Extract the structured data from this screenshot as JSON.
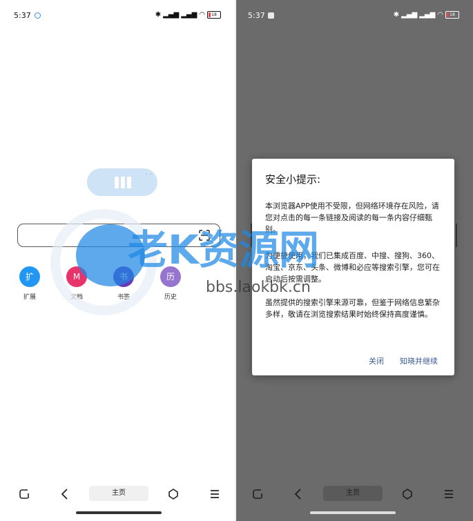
{
  "left_screen": {
    "status_bar": {
      "time": "5:37",
      "battery": "18",
      "signal_icons": [
        "bluetooth-icon",
        "signal-icon",
        "signal-icon",
        "wifi-icon",
        "battery-icon"
      ]
    },
    "search": {
      "value": "",
      "placeholder": "",
      "icon": "scan-icon"
    },
    "shortcuts": [
      {
        "glyph": "扩",
        "label": "扩展",
        "color": "#2196f3"
      },
      {
        "glyph": "M",
        "label": "文档",
        "color": "#e8336b"
      },
      {
        "glyph": "书",
        "label": "书签",
        "color": "#673ab7"
      },
      {
        "glyph": "历",
        "label": "历史",
        "color": "#9575cd"
      }
    ],
    "navbar": {
      "home_label": "主页",
      "icons": [
        "tabs-icon",
        "back-icon",
        "home-icon",
        "menu-icon"
      ]
    }
  },
  "right_screen": {
    "status_bar": {
      "time": "5:37",
      "battery": "18"
    },
    "dialog": {
      "title": "安全小提示:",
      "para1": "本浏览器APP使用不受限，但网络环境存在风险，请您对点击的每一条链接及阅读的每一条内容仔细甄别。",
      "para2": "为便捷使用，我们已集成百度、中搜、搜狗、360、淘宝、京东、头条、微博和必应等搜索引擎，您可在启动后按需调整。",
      "para3": "虽然提供的搜索引擎来源可靠，但鉴于网络信息繁杂多样，敬请在浏览搜索结果时始终保持高度谨慎。",
      "close_label": "关闭",
      "continue_label": "知晓并继续"
    },
    "navbar": {
      "home_label": "主页"
    }
  },
  "watermark": {
    "text": "老K资源网",
    "url": "bbs.laokbk.cn"
  },
  "colors": {
    "overlay": "#6b6b6b",
    "dialog_button": "#3c5a93",
    "accent": "#1e88e5"
  }
}
